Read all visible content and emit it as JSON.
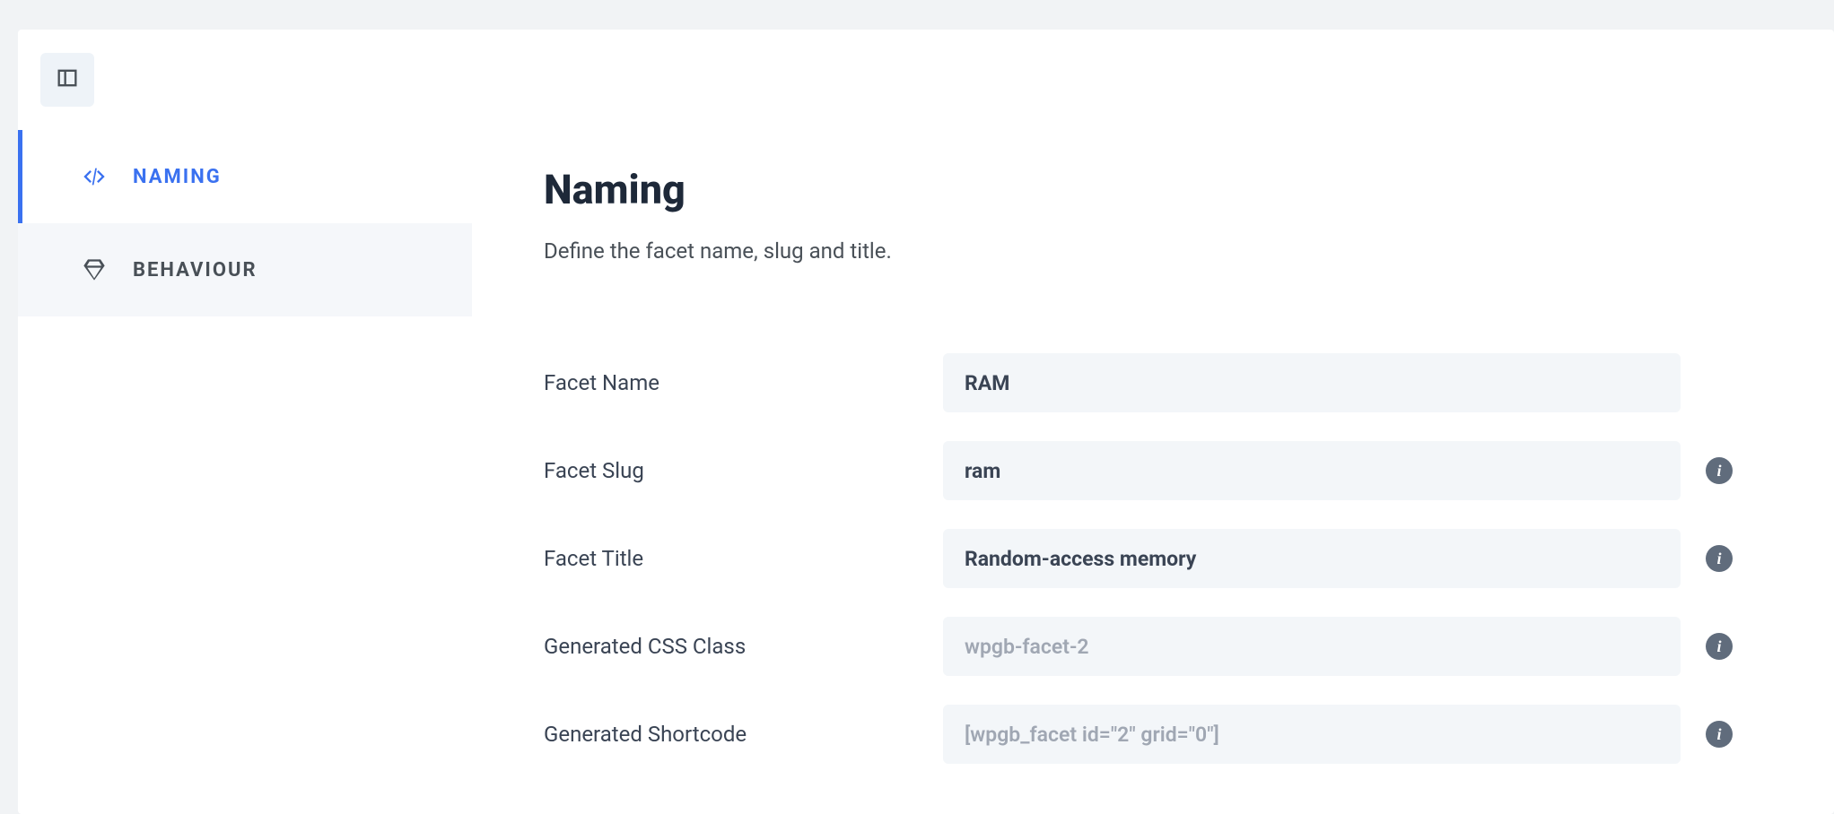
{
  "sidebar": {
    "items": [
      {
        "label": "NAMING",
        "icon": "code-icon"
      },
      {
        "label": "BEHAVIOUR",
        "icon": "diamond-icon"
      }
    ]
  },
  "main": {
    "title": "Naming",
    "subtitle": "Define the facet name, slug and title.",
    "fields": {
      "facet_name": {
        "label": "Facet Name",
        "value": "RAM"
      },
      "facet_slug": {
        "label": "Facet Slug",
        "value": "ram"
      },
      "facet_title": {
        "label": "Facet Title",
        "value": "Random-access memory"
      },
      "generated_css_class": {
        "label": "Generated CSS Class",
        "value": "wpgb-facet-2"
      },
      "generated_shortcode": {
        "label": "Generated Shortcode",
        "value": "[wpgb_facet id=\"2\" grid=\"0\"]"
      }
    }
  }
}
